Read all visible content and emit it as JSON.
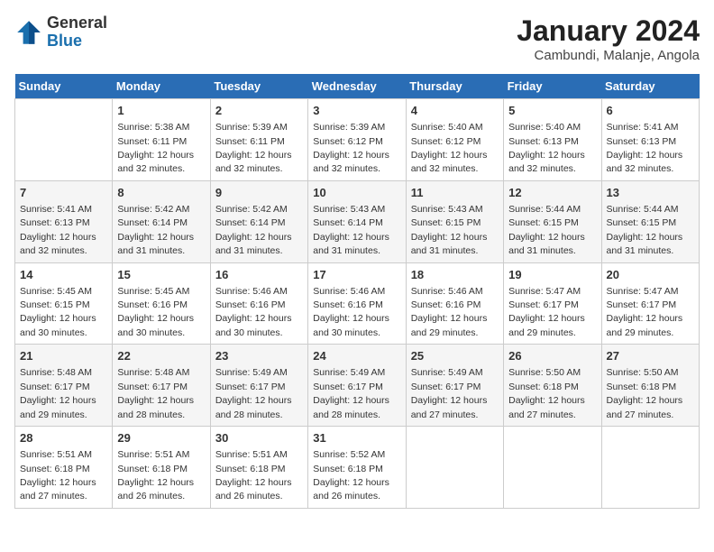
{
  "header": {
    "logo_general": "General",
    "logo_blue": "Blue",
    "month_year": "January 2024",
    "location": "Cambundi, Malanje, Angola"
  },
  "days_of_week": [
    "Sunday",
    "Monday",
    "Tuesday",
    "Wednesday",
    "Thursday",
    "Friday",
    "Saturday"
  ],
  "weeks": [
    [
      null,
      {
        "day": 1,
        "sunrise": "5:38 AM",
        "sunset": "6:11 PM",
        "daylight": "12 hours and 32 minutes."
      },
      {
        "day": 2,
        "sunrise": "5:39 AM",
        "sunset": "6:11 PM",
        "daylight": "12 hours and 32 minutes."
      },
      {
        "day": 3,
        "sunrise": "5:39 AM",
        "sunset": "6:12 PM",
        "daylight": "12 hours and 32 minutes."
      },
      {
        "day": 4,
        "sunrise": "5:40 AM",
        "sunset": "6:12 PM",
        "daylight": "12 hours and 32 minutes."
      },
      {
        "day": 5,
        "sunrise": "5:40 AM",
        "sunset": "6:13 PM",
        "daylight": "12 hours and 32 minutes."
      },
      {
        "day": 6,
        "sunrise": "5:41 AM",
        "sunset": "6:13 PM",
        "daylight": "12 hours and 32 minutes."
      }
    ],
    [
      {
        "day": 7,
        "sunrise": "5:41 AM",
        "sunset": "6:13 PM",
        "daylight": "12 hours and 32 minutes."
      },
      {
        "day": 8,
        "sunrise": "5:42 AM",
        "sunset": "6:14 PM",
        "daylight": "12 hours and 31 minutes."
      },
      {
        "day": 9,
        "sunrise": "5:42 AM",
        "sunset": "6:14 PM",
        "daylight": "12 hours and 31 minutes."
      },
      {
        "day": 10,
        "sunrise": "5:43 AM",
        "sunset": "6:14 PM",
        "daylight": "12 hours and 31 minutes."
      },
      {
        "day": 11,
        "sunrise": "5:43 AM",
        "sunset": "6:15 PM",
        "daylight": "12 hours and 31 minutes."
      },
      {
        "day": 12,
        "sunrise": "5:44 AM",
        "sunset": "6:15 PM",
        "daylight": "12 hours and 31 minutes."
      },
      {
        "day": 13,
        "sunrise": "5:44 AM",
        "sunset": "6:15 PM",
        "daylight": "12 hours and 31 minutes."
      }
    ],
    [
      {
        "day": 14,
        "sunrise": "5:45 AM",
        "sunset": "6:15 PM",
        "daylight": "12 hours and 30 minutes."
      },
      {
        "day": 15,
        "sunrise": "5:45 AM",
        "sunset": "6:16 PM",
        "daylight": "12 hours and 30 minutes."
      },
      {
        "day": 16,
        "sunrise": "5:46 AM",
        "sunset": "6:16 PM",
        "daylight": "12 hours and 30 minutes."
      },
      {
        "day": 17,
        "sunrise": "5:46 AM",
        "sunset": "6:16 PM",
        "daylight": "12 hours and 30 minutes."
      },
      {
        "day": 18,
        "sunrise": "5:46 AM",
        "sunset": "6:16 PM",
        "daylight": "12 hours and 29 minutes."
      },
      {
        "day": 19,
        "sunrise": "5:47 AM",
        "sunset": "6:17 PM",
        "daylight": "12 hours and 29 minutes."
      },
      {
        "day": 20,
        "sunrise": "5:47 AM",
        "sunset": "6:17 PM",
        "daylight": "12 hours and 29 minutes."
      }
    ],
    [
      {
        "day": 21,
        "sunrise": "5:48 AM",
        "sunset": "6:17 PM",
        "daylight": "12 hours and 29 minutes."
      },
      {
        "day": 22,
        "sunrise": "5:48 AM",
        "sunset": "6:17 PM",
        "daylight": "12 hours and 28 minutes."
      },
      {
        "day": 23,
        "sunrise": "5:49 AM",
        "sunset": "6:17 PM",
        "daylight": "12 hours and 28 minutes."
      },
      {
        "day": 24,
        "sunrise": "5:49 AM",
        "sunset": "6:17 PM",
        "daylight": "12 hours and 28 minutes."
      },
      {
        "day": 25,
        "sunrise": "5:49 AM",
        "sunset": "6:17 PM",
        "daylight": "12 hours and 27 minutes."
      },
      {
        "day": 26,
        "sunrise": "5:50 AM",
        "sunset": "6:18 PM",
        "daylight": "12 hours and 27 minutes."
      },
      {
        "day": 27,
        "sunrise": "5:50 AM",
        "sunset": "6:18 PM",
        "daylight": "12 hours and 27 minutes."
      }
    ],
    [
      {
        "day": 28,
        "sunrise": "5:51 AM",
        "sunset": "6:18 PM",
        "daylight": "12 hours and 27 minutes."
      },
      {
        "day": 29,
        "sunrise": "5:51 AM",
        "sunset": "6:18 PM",
        "daylight": "12 hours and 26 minutes."
      },
      {
        "day": 30,
        "sunrise": "5:51 AM",
        "sunset": "6:18 PM",
        "daylight": "12 hours and 26 minutes."
      },
      {
        "day": 31,
        "sunrise": "5:52 AM",
        "sunset": "6:18 PM",
        "daylight": "12 hours and 26 minutes."
      },
      null,
      null,
      null
    ]
  ]
}
